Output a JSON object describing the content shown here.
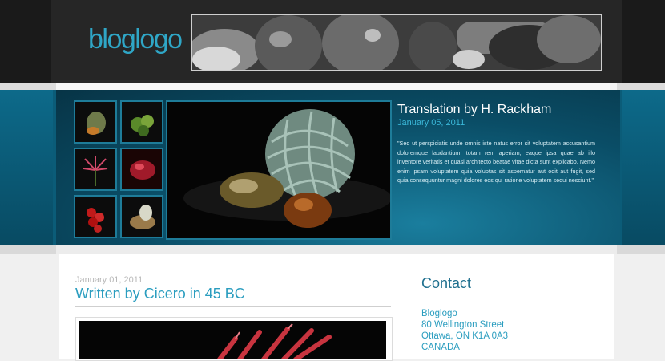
{
  "site": {
    "logo_text": "bloglogo"
  },
  "featured": {
    "title": "Translation by H. Rackham",
    "date": "January 05, 2011",
    "excerpt": "\"Sed ut perspiciatis unde omnis iste natus error sit voluptatem accusantium doloremque laudantium, totam rem aperiam, eaque ipsa quae ab illo inventore veritatis et quasi architecto beatae vitae dicta sunt explicabo. Nemo enim ipsam voluptatem quia voluptas sit aspernatur aut odit aut fugit, sed quia consequuntur magni dolores eos qui ratione voluptatem sequi nesciunt.\""
  },
  "post": {
    "date": "January 01, 2011",
    "title": "Written by Cicero in 45 BC"
  },
  "contact": {
    "heading": "Contact",
    "lines": [
      "Bloglogo",
      "80 Wellington Street",
      "Ottawa, ON  K1A 0A3",
      "CANADA"
    ]
  },
  "colors": {
    "accent": "#2fa6c6",
    "band": "#0b5c78",
    "header": "#262626"
  }
}
